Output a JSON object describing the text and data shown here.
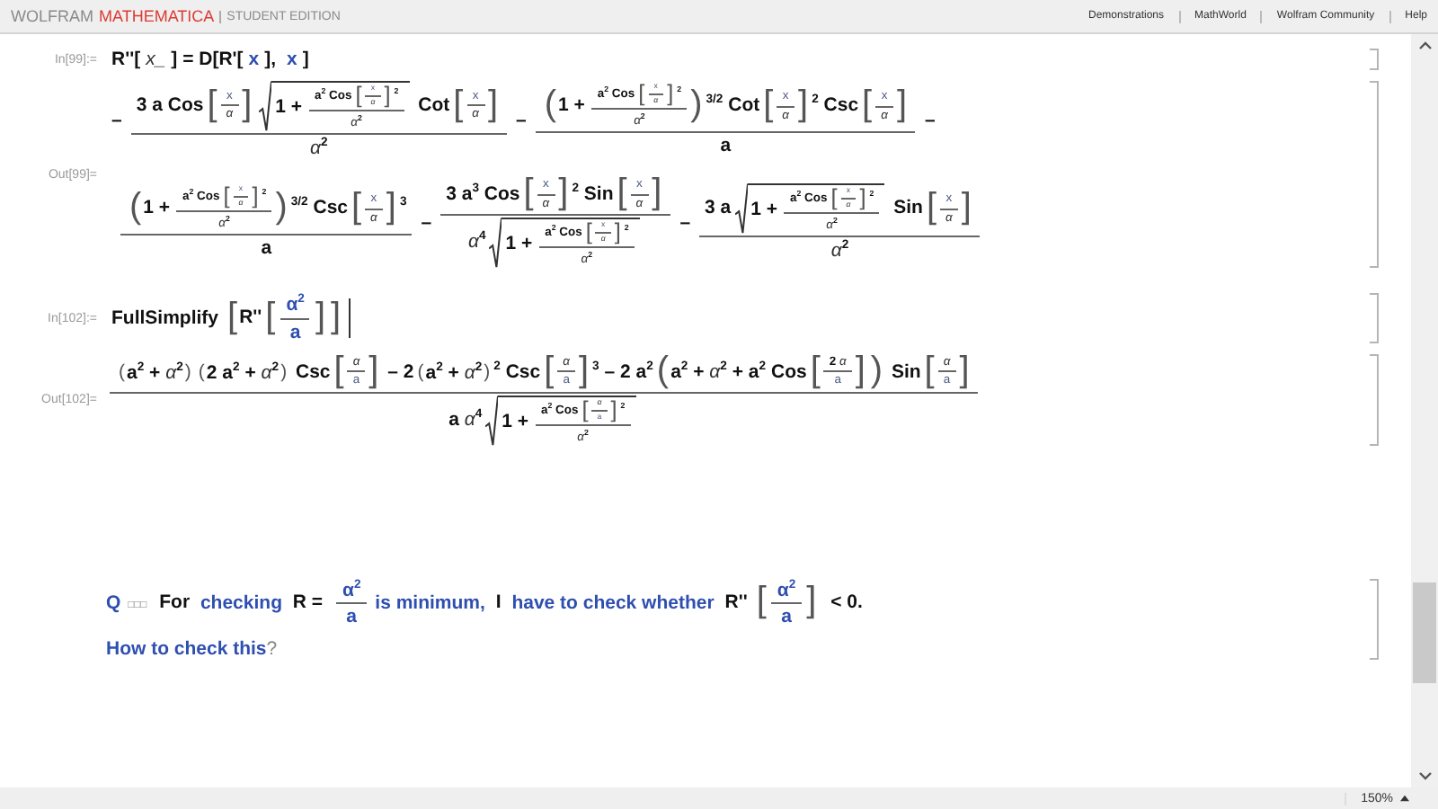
{
  "header": {
    "brand": [
      {
        "text": "WOLFRAM",
        "kind": "maker"
      },
      {
        "text": "MATHEMATICA",
        "kind": "product"
      },
      {
        "text": "STUDENT EDITION",
        "kind": "edition"
      }
    ],
    "links": [
      "Demonstrations",
      "MathWorld",
      "Wolfram Community",
      "Help"
    ]
  },
  "cells": [
    {
      "kind": "input",
      "label": "In[99]:=",
      "lines": [
        [
          "R''[",
          {
            "kind": "var",
            "text": "x_"
          },
          "] = D[R'[",
          {
            "kind": "sym",
            "text": "x"
          },
          "], ",
          {
            "kind": "sym",
            "text": "x"
          },
          "]"
        ]
      ]
    },
    {
      "kind": "output",
      "label": "Out[99]=",
      "lines": [
        [
          "–",
          {
            "kind": "frac",
            "num": [
              "3 a Cos",
              {
                "kind": "group",
                "open": "[",
                "close": "]",
                "body": [
                  {
                    "kind": "smallfrac",
                    "num": [
                      {
                        "kind": "sym",
                        "text": "x"
                      }
                    ],
                    "den": [
                      {
                        "kind": "var",
                        "text": "α"
                      }
                    ]
                  }
                ]
              },
              {
                "kind": "sqrt",
                "body": [
                  "1 + ",
                  {
                    "kind": "smallfrac",
                    "num": [
                      "a",
                      {
                        "kind": "sup",
                        "text": "2"
                      },
                      " Cos",
                      {
                        "kind": "group",
                        "open": "[",
                        "close": "]",
                        "body": [
                          {
                            "kind": "smallfrac",
                            "num": [
                              {
                                "kind": "sym",
                                "text": "x"
                              }
                            ],
                            "den": [
                              {
                                "kind": "var",
                                "text": "α"
                              }
                            ]
                          }
                        ]
                      },
                      {
                        "kind": "sup",
                        "text": "2"
                      }
                    ],
                    "den": [
                      {
                        "kind": "var",
                        "text": "α"
                      },
                      {
                        "kind": "sup",
                        "text": "2"
                      }
                    ]
                  }
                ]
              },
              " Cot",
              {
                "kind": "group",
                "open": "[",
                "close": "]",
                "body": [
                  {
                    "kind": "smallfrac",
                    "num": [
                      {
                        "kind": "sym",
                        "text": "x"
                      }
                    ],
                    "den": [
                      {
                        "kind": "var",
                        "text": "α"
                      }
                    ]
                  }
                ]
              }
            ],
            "den": [
              {
                "kind": "var",
                "text": "α"
              },
              {
                "kind": "sup",
                "text": "2"
              }
            ]
          },
          "–",
          {
            "kind": "frac",
            "num": [
              {
                "kind": "group",
                "open": "(",
                "close": ")",
                "body": [
                  "1 + ",
                  {
                    "kind": "smallfrac",
                    "num": [
                      "a",
                      {
                        "kind": "sup",
                        "text": "2"
                      },
                      " Cos",
                      {
                        "kind": "group",
                        "open": "[",
                        "close": "]",
                        "body": [
                          {
                            "kind": "smallfrac",
                            "num": [
                              {
                                "kind": "sym",
                                "text": "x"
                              }
                            ],
                            "den": [
                              {
                                "kind": "var",
                                "text": "α"
                              }
                            ]
                          }
                        ]
                      },
                      {
                        "kind": "sup",
                        "text": "2"
                      }
                    ],
                    "den": [
                      {
                        "kind": "var",
                        "text": "α"
                      },
                      {
                        "kind": "sup",
                        "text": "2"
                      }
                    ]
                  }
                ]
              },
              {
                "kind": "sup",
                "text": "3/2"
              },
              " Cot",
              {
                "kind": "group",
                "open": "[",
                "close": "]",
                "body": [
                  {
                    "kind": "smallfrac",
                    "num": [
                      {
                        "kind": "sym",
                        "text": "x"
                      }
                    ],
                    "den": [
                      {
                        "kind": "var",
                        "text": "α"
                      }
                    ]
                  }
                ]
              },
              {
                "kind": "sup",
                "text": "2"
              },
              " Csc",
              {
                "kind": "group",
                "open": "[",
                "close": "]",
                "body": [
                  {
                    "kind": "smallfrac",
                    "num": [
                      {
                        "kind": "sym",
                        "text": "x"
                      }
                    ],
                    "den": [
                      {
                        "kind": "var",
                        "text": "α"
                      }
                    ]
                  }
                ]
              }
            ],
            "den": [
              "a"
            ]
          },
          "–"
        ],
        [
          {
            "kind": "frac",
            "num": [
              {
                "kind": "group",
                "open": "(",
                "close": ")",
                "body": [
                  "1 + ",
                  {
                    "kind": "smallfrac",
                    "num": [
                      "a",
                      {
                        "kind": "sup",
                        "text": "2"
                      },
                      " Cos",
                      {
                        "kind": "group",
                        "open": "[",
                        "close": "]",
                        "body": [
                          {
                            "kind": "smallfrac",
                            "num": [
                              {
                                "kind": "sym",
                                "text": "x"
                              }
                            ],
                            "den": [
                              {
                                "kind": "var",
                                "text": "α"
                              }
                            ]
                          }
                        ]
                      },
                      {
                        "kind": "sup",
                        "text": "2"
                      }
                    ],
                    "den": [
                      {
                        "kind": "var",
                        "text": "α"
                      },
                      {
                        "kind": "sup",
                        "text": "2"
                      }
                    ]
                  }
                ]
              },
              {
                "kind": "sup",
                "text": "3/2"
              },
              " Csc",
              {
                "kind": "group",
                "open": "[",
                "close": "]",
                "body": [
                  {
                    "kind": "smallfrac",
                    "num": [
                      {
                        "kind": "sym",
                        "text": "x"
                      }
                    ],
                    "den": [
                      {
                        "kind": "var",
                        "text": "α"
                      }
                    ]
                  }
                ]
              },
              {
                "kind": "sup",
                "text": "3"
              }
            ],
            "den": [
              "a"
            ]
          },
          "–",
          {
            "kind": "frac",
            "num": [
              "3 a",
              {
                "kind": "sup",
                "text": "3"
              },
              " Cos",
              {
                "kind": "group",
                "open": "[",
                "close": "]",
                "body": [
                  {
                    "kind": "smallfrac",
                    "num": [
                      {
                        "kind": "sym",
                        "text": "x"
                      }
                    ],
                    "den": [
                      {
                        "kind": "var",
                        "text": "α"
                      }
                    ]
                  }
                ]
              },
              {
                "kind": "sup",
                "text": "2"
              },
              " Sin",
              {
                "kind": "group",
                "open": "[",
                "close": "]",
                "body": [
                  {
                    "kind": "smallfrac",
                    "num": [
                      {
                        "kind": "sym",
                        "text": "x"
                      }
                    ],
                    "den": [
                      {
                        "kind": "var",
                        "text": "α"
                      }
                    ]
                  }
                ]
              }
            ],
            "den": [
              {
                "kind": "var",
                "text": "α"
              },
              {
                "kind": "sup",
                "text": "4"
              },
              {
                "kind": "sqrt",
                "body": [
                  "1 + ",
                  {
                    "kind": "smallfrac",
                    "num": [
                      "a",
                      {
                        "kind": "sup",
                        "text": "2"
                      },
                      " Cos",
                      {
                        "kind": "group",
                        "open": "[",
                        "close": "]",
                        "body": [
                          {
                            "kind": "smallfrac",
                            "num": [
                              {
                                "kind": "sym",
                                "text": "x"
                              }
                            ],
                            "den": [
                              {
                                "kind": "var",
                                "text": "α"
                              }
                            ]
                          }
                        ]
                      },
                      {
                        "kind": "sup",
                        "text": "2"
                      }
                    ],
                    "den": [
                      {
                        "kind": "var",
                        "text": "α"
                      },
                      {
                        "kind": "sup",
                        "text": "2"
                      }
                    ]
                  }
                ]
              }
            ]
          },
          "–",
          {
            "kind": "frac",
            "num": [
              "3 a",
              {
                "kind": "sqrt",
                "body": [
                  "1 + ",
                  {
                    "kind": "smallfrac",
                    "num": [
                      "a",
                      {
                        "kind": "sup",
                        "text": "2"
                      },
                      " Cos",
                      {
                        "kind": "group",
                        "open": "[",
                        "close": "]",
                        "body": [
                          {
                            "kind": "smallfrac",
                            "num": [
                              {
                                "kind": "sym",
                                "text": "x"
                              }
                            ],
                            "den": [
                              {
                                "kind": "var",
                                "text": "α"
                              }
                            ]
                          }
                        ]
                      },
                      {
                        "kind": "sup",
                        "text": "2"
                      }
                    ],
                    "den": [
                      {
                        "kind": "var",
                        "text": "α"
                      },
                      {
                        "kind": "sup",
                        "text": "2"
                      }
                    ]
                  }
                ]
              },
              " Sin",
              {
                "kind": "group",
                "open": "[",
                "close": "]",
                "body": [
                  {
                    "kind": "smallfrac",
                    "num": [
                      {
                        "kind": "sym",
                        "text": "x"
                      }
                    ],
                    "den": [
                      {
                        "kind": "var",
                        "text": "α"
                      }
                    ]
                  }
                ]
              }
            ],
            "den": [
              {
                "kind": "var",
                "text": "α"
              },
              {
                "kind": "sup",
                "text": "2"
              }
            ]
          }
        ]
      ]
    },
    {
      "kind": "input",
      "label": "In[102]:=",
      "cursor": true,
      "lines": [
        [
          "FullSimplify",
          {
            "kind": "group",
            "open": "[",
            "close": "]",
            "body": [
              "R''",
              {
                "kind": "group",
                "open": "[",
                "close": "]",
                "body": [
                  {
                    "kind": "symfrac",
                    "num": [
                      "α",
                      {
                        "kind": "sup",
                        "text": "2"
                      }
                    ],
                    "den": [
                      "a"
                    ]
                  }
                ]
              }
            ]
          }
        ]
      ]
    },
    {
      "kind": "output",
      "label": "Out[102]=",
      "lines": [
        [
          {
            "kind": "frac",
            "num": [
              {
                "kind": "group",
                "open": "(",
                "close": ")",
                "body": [
                  "a",
                  {
                    "kind": "sup",
                    "text": "2"
                  },
                  " + ",
                  {
                    "kind": "var",
                    "text": "α"
                  },
                  {
                    "kind": "sup",
                    "text": "2"
                  }
                ]
              },
              {
                "kind": "group",
                "open": "(",
                "close": ")",
                "body": [
                  "2 a",
                  {
                    "kind": "sup",
                    "text": "2"
                  },
                  " + ",
                  {
                    "kind": "var",
                    "text": "α"
                  },
                  {
                    "kind": "sup",
                    "text": "2"
                  }
                ]
              },
              " Csc",
              {
                "kind": "group",
                "open": "[",
                "close": "]",
                "body": [
                  {
                    "kind": "smallfrac",
                    "num": [
                      {
                        "kind": "var",
                        "text": "α"
                      }
                    ],
                    "den": [
                      {
                        "kind": "sym",
                        "text": "a"
                      }
                    ]
                  }
                ]
              },
              " – 2",
              {
                "kind": "group",
                "open": "(",
                "close": ")",
                "body": [
                  "a",
                  {
                    "kind": "sup",
                    "text": "2"
                  },
                  " + ",
                  {
                    "kind": "var",
                    "text": "α"
                  },
                  {
                    "kind": "sup",
                    "text": "2"
                  }
                ]
              },
              {
                "kind": "sup",
                "text": "2"
              },
              " Csc",
              {
                "kind": "group",
                "open": "[",
                "close": "]",
                "body": [
                  {
                    "kind": "smallfrac",
                    "num": [
                      {
                        "kind": "var",
                        "text": "α"
                      }
                    ],
                    "den": [
                      {
                        "kind": "sym",
                        "text": "a"
                      }
                    ]
                  }
                ]
              },
              {
                "kind": "sup",
                "text": "3"
              },
              " – 2 a",
              {
                "kind": "sup",
                "text": "2"
              },
              {
                "kind": "group",
                "open": "(",
                "close": ")",
                "body": [
                  "a",
                  {
                    "kind": "sup",
                    "text": "2"
                  },
                  " + ",
                  {
                    "kind": "var",
                    "text": "α"
                  },
                  {
                    "kind": "sup",
                    "text": "2"
                  },
                  " + a",
                  {
                    "kind": "sup",
                    "text": "2"
                  },
                  " Cos",
                  {
                    "kind": "group",
                    "open": "[",
                    "close": "]",
                    "body": [
                      {
                        "kind": "smallfrac",
                        "num": [
                          "2 ",
                          {
                            "kind": "var",
                            "text": "α"
                          }
                        ],
                        "den": [
                          {
                            "kind": "sym",
                            "text": "a"
                          }
                        ]
                      }
                    ]
                  }
                ]
              },
              " Sin",
              {
                "kind": "group",
                "open": "[",
                "close": "]",
                "body": [
                  {
                    "kind": "smallfrac",
                    "num": [
                      {
                        "kind": "var",
                        "text": "α"
                      }
                    ],
                    "den": [
                      {
                        "kind": "sym",
                        "text": "a"
                      }
                    ]
                  }
                ]
              }
            ],
            "den": [
              "a ",
              {
                "kind": "var",
                "text": "α"
              },
              {
                "kind": "sup",
                "text": "4"
              },
              {
                "kind": "sqrt",
                "body": [
                  "1 + ",
                  {
                    "kind": "smallfrac",
                    "num": [
                      "a",
                      {
                        "kind": "sup",
                        "text": "2"
                      },
                      " Cos",
                      {
                        "kind": "group",
                        "open": "[",
                        "close": "]",
                        "body": [
                          {
                            "kind": "smallfrac",
                            "num": [
                              {
                                "kind": "var",
                                "text": "α"
                              }
                            ],
                            "den": [
                              {
                                "kind": "sym",
                                "text": "a"
                              }
                            ]
                          }
                        ]
                      },
                      {
                        "kind": "sup",
                        "text": "2"
                      }
                    ],
                    "den": [
                      {
                        "kind": "var",
                        "text": "α"
                      },
                      {
                        "kind": "sup",
                        "text": "2"
                      }
                    ]
                  }
                ]
              }
            ]
          }
        ]
      ]
    },
    {
      "kind": "text",
      "lines": [
        [
          {
            "kind": "sym",
            "text": "Q"
          },
          {
            "kind": "sub",
            "text": "□□□"
          },
          "For ",
          {
            "kind": "sym",
            "text": "checking "
          },
          "R = ",
          {
            "kind": "symfrac",
            "num": [
              "α",
              {
                "kind": "sup",
                "text": "2"
              }
            ],
            "den": [
              "a"
            ]
          },
          {
            "kind": "sym",
            "text": " is minimum, "
          },
          "I ",
          {
            "kind": "sym",
            "text": "have to check whether "
          },
          "R''",
          {
            "kind": "group",
            "open": "[",
            "close": "]",
            "body": [
              {
                "kind": "symfrac",
                "num": [
                  "α",
                  {
                    "kind": "sup",
                    "text": "2"
                  }
                ],
                "den": [
                  "a"
                ]
              }
            ]
          },
          " < 0."
        ],
        [
          {
            "kind": "sym",
            "text": "How to check this"
          },
          {
            "kind": "note",
            "text": "?"
          }
        ]
      ]
    }
  ],
  "status_bar": {
    "zoom": "150%"
  }
}
